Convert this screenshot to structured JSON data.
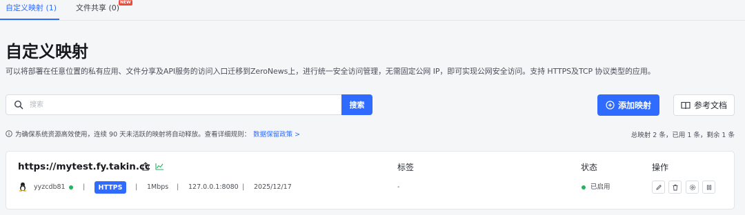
{
  "tabs": [
    {
      "label": "自定义映射 (1)",
      "active": true
    },
    {
      "label": "文件共享 (0)",
      "badge": "NEW"
    }
  ],
  "page": {
    "title": "自定义映射",
    "description": "可以将部署在任意位置的私有应用、文件分享及API服务的访问入口迁移到ZeroNews上，进行统一安全访问管理，无需固定公网 IP，即可实现公网安全访问。支持 HTTPS及TCP 协议类型的应用。"
  },
  "search": {
    "placeholder": "搜索",
    "button_label": "搜索"
  },
  "actions": {
    "add_label": "添加映射",
    "docs_label": "参考文档"
  },
  "notice": {
    "text": "为确保系统资源高效使用，连续 90 天未活跃的映射将自动释放。查看详细规则：",
    "link_label": "数据保留政策 >"
  },
  "summary": "总映射 2 条，已用 1 条，剩余 1 条",
  "columns": {
    "tags": "标签",
    "status": "状态",
    "ops": "操作"
  },
  "mapping": {
    "domain": "https://mytest.fy.takin.cc",
    "agent": "yyzcdb81",
    "protocol": "HTTPS",
    "bandwidth": "1Mbps",
    "target": "127.0.0.1:8080",
    "date": "2025/12/17",
    "tags": "-",
    "status": "已启用",
    "separator": "|"
  },
  "colors": {
    "accent": "#2f6bff",
    "online": "#22b55d",
    "badge_new": "#f04a3a"
  },
  "icons": [
    "search-icon",
    "plus-circle-icon",
    "book-icon",
    "info-icon",
    "share-icon",
    "chart-icon",
    "linux-icon",
    "edit-icon",
    "delete-icon",
    "settings-icon",
    "pause-icon"
  ]
}
